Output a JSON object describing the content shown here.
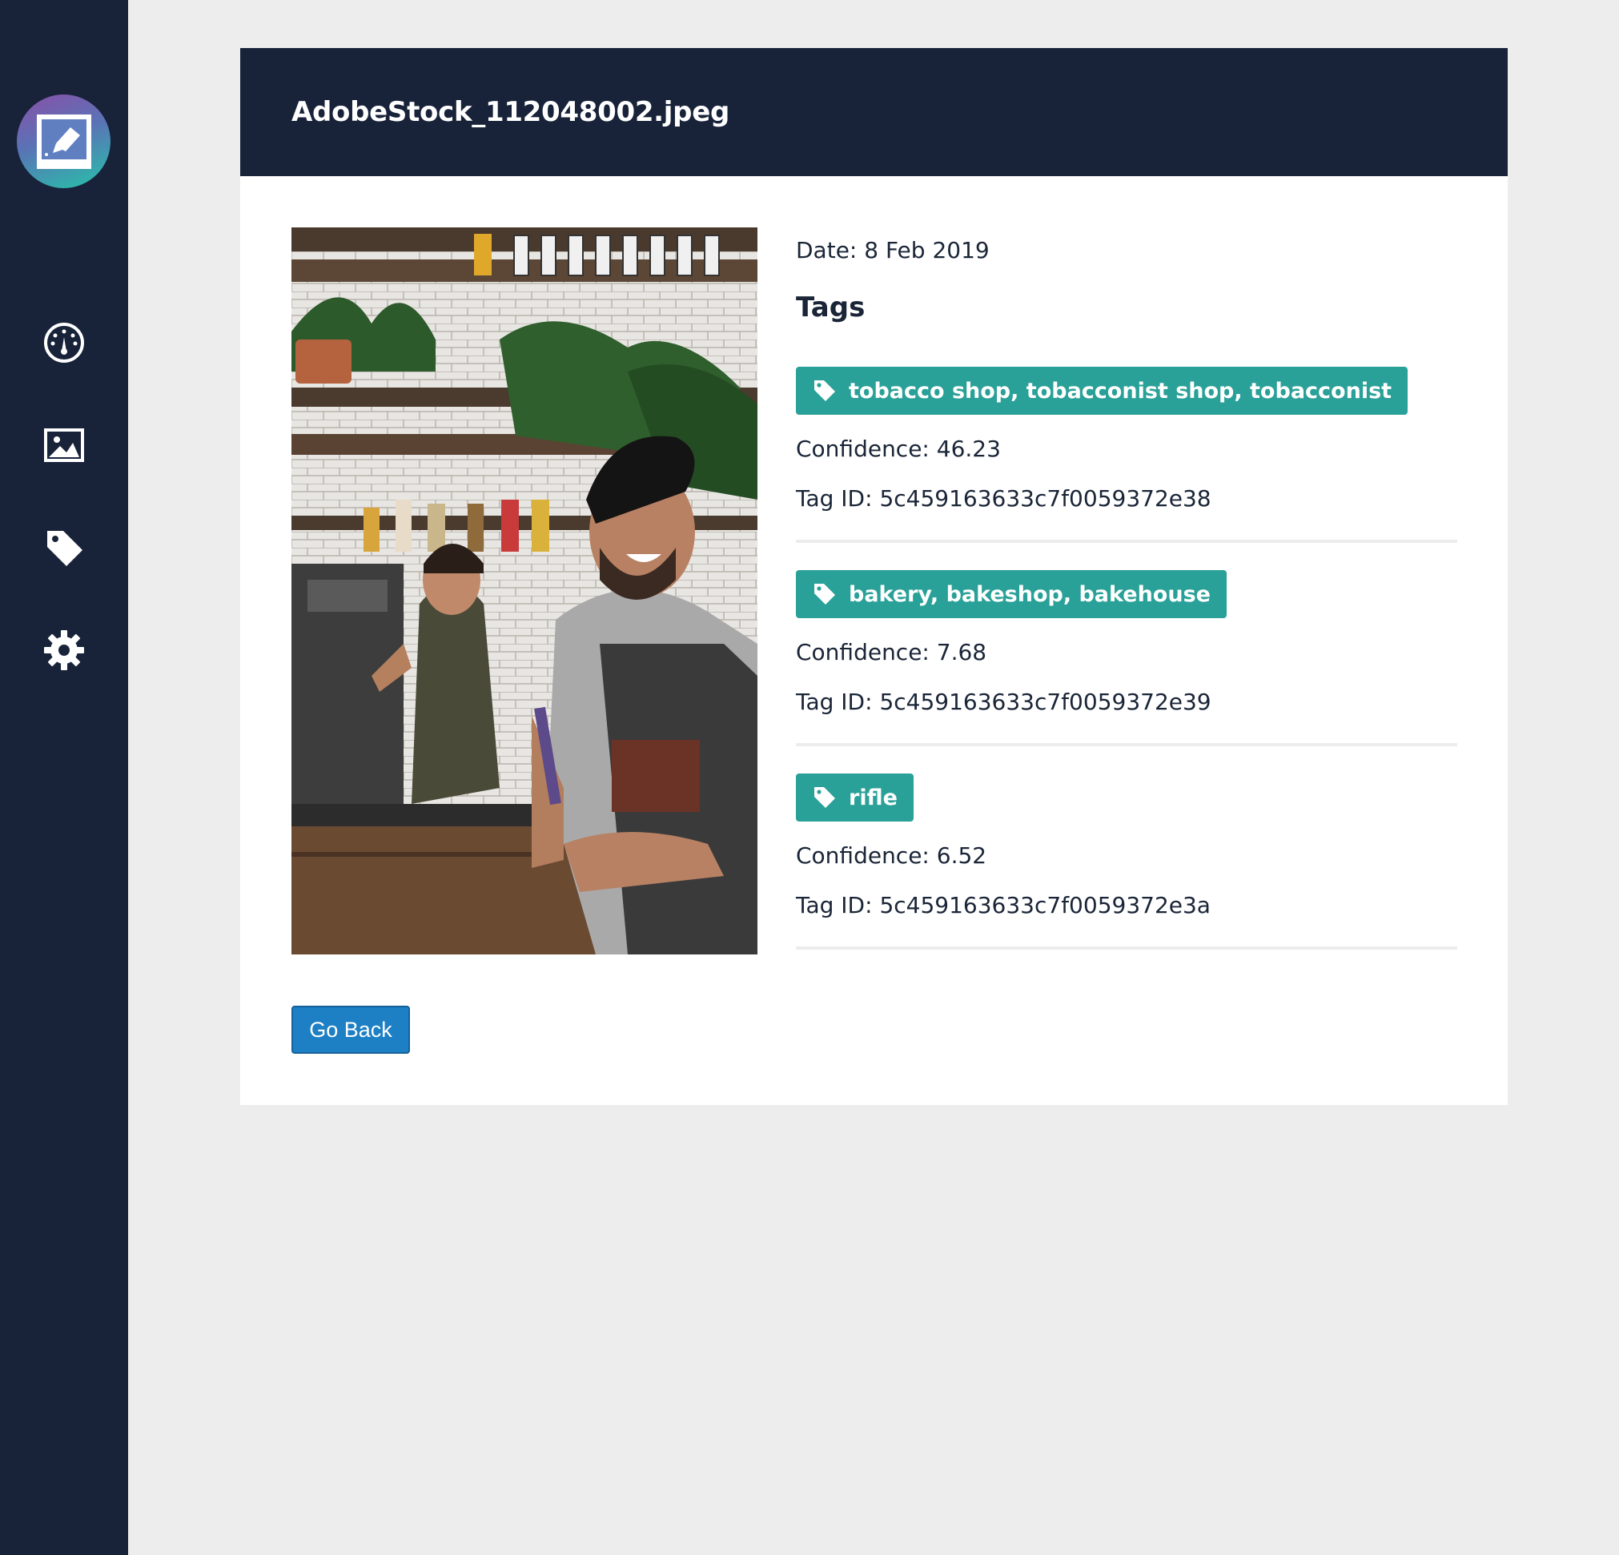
{
  "sidebar": {
    "logo_icon": "photo-tag-logo-icon",
    "items": [
      {
        "name": "dashboard",
        "icon": "gauge-icon"
      },
      {
        "name": "images",
        "icon": "image-icon"
      },
      {
        "name": "tags",
        "icon": "tag-icon"
      },
      {
        "name": "settings",
        "icon": "gear-icon"
      }
    ]
  },
  "header": {
    "title": "AdobeStock_112048002.jpeg"
  },
  "details": {
    "date_label": "Date: 8 Feb 2019",
    "tags_heading": "Tags",
    "tags": [
      {
        "label": "tobacco shop, tobacconist shop, tobacconist",
        "confidence": "Confidence: 46.23",
        "tag_id": "Tag ID: 5c459163633c7f0059372e38"
      },
      {
        "label": "bakery, bakeshop, bakehouse",
        "confidence": "Confidence: 7.68",
        "tag_id": "Tag ID: 5c459163633c7f0059372e39"
      },
      {
        "label": "rifle",
        "confidence": "Confidence: 6.52",
        "tag_id": "Tag ID: 5c459163633c7f0059372e3a"
      }
    ]
  },
  "actions": {
    "back_label": "Go Back"
  },
  "colors": {
    "sidebar_bg": "#18233a",
    "header_bg": "#18233a",
    "page_bg": "#ededed",
    "tag_badge_bg": "#2aa198",
    "button_bg": "#1d7fc4"
  }
}
